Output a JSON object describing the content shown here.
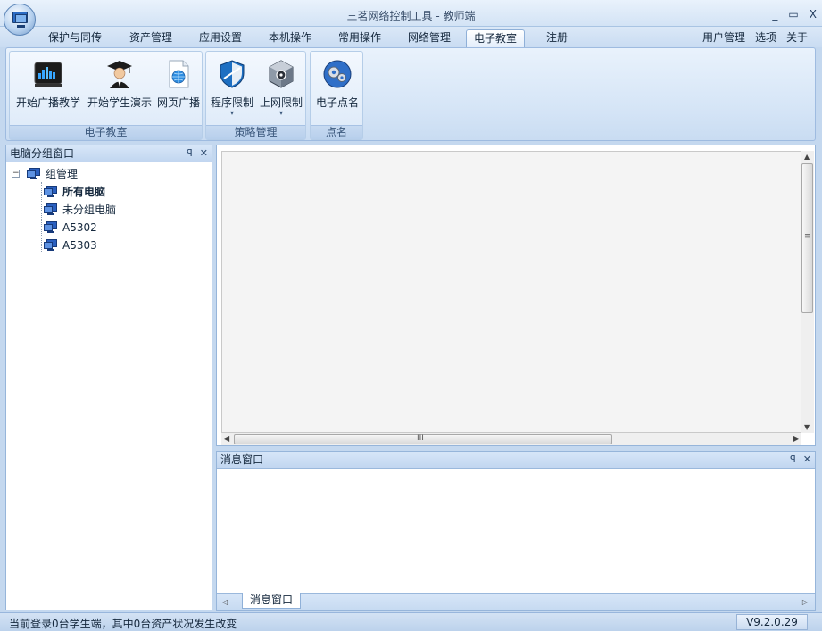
{
  "window": {
    "title": "三茗网络控制工具 - 教师端",
    "controls": [
      "_",
      "▭",
      "X"
    ]
  },
  "ribbon": {
    "tabs": [
      "保护与同传",
      "资产管理",
      "应用设置",
      "本机操作",
      "常用操作",
      "网络管理",
      "电子教室",
      "注册"
    ],
    "active_tab": "电子教室",
    "right_links": [
      "用户管理",
      "选项",
      "关于"
    ],
    "groups": [
      {
        "label": "电子教室",
        "buttons": [
          {
            "label": "开始广播教学",
            "icon": "broadcast-screen-icon"
          },
          {
            "label": "开始学生演示",
            "icon": "student-graduate-icon"
          },
          {
            "label": "网页广播",
            "icon": "web-page-icon"
          }
        ]
      },
      {
        "label": "策略管理",
        "buttons": [
          {
            "label": "程序限制",
            "icon": "shield-icon",
            "dropdown": "▾"
          },
          {
            "label": "上网限制",
            "icon": "cube-lock-icon",
            "dropdown": "▾"
          }
        ]
      },
      {
        "label": "点名",
        "buttons": [
          {
            "label": "电子点名",
            "icon": "gears-icon"
          }
        ]
      }
    ]
  },
  "left_panel": {
    "title": "电脑分组窗口",
    "pin": "ꟼ",
    "close": "✕",
    "tree_root": {
      "label": "组管理",
      "expander": "−"
    },
    "tree_children": [
      "所有电脑",
      "未分组电脑",
      "A5302",
      "A5303"
    ]
  },
  "message_panel": {
    "title": "消息窗口",
    "pin": "ꟼ",
    "close": "✕",
    "tab": "消息窗口"
  },
  "scrollbar_grip": {
    "v": "≡",
    "h": "III"
  },
  "status": {
    "text": "当前登录0台学生端，其中0台资产状况发生改变",
    "version": "V9.2.0.29"
  }
}
